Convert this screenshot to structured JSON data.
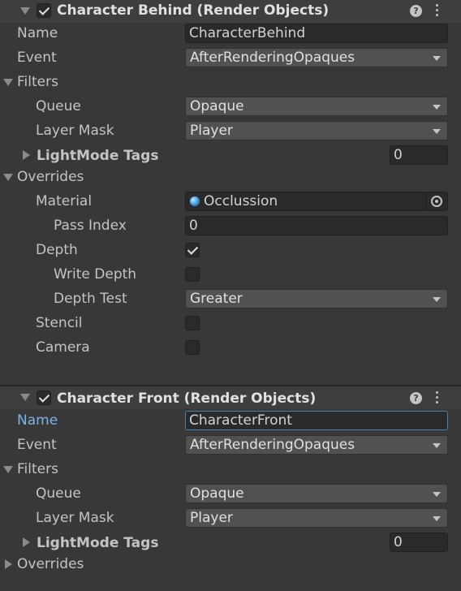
{
  "features": [
    {
      "title": "Character Behind (Render Objects)",
      "enabled": true,
      "name_label": "Name",
      "name_value": "CharacterBehind",
      "event_label": "Event",
      "event_value": "AfterRenderingOpaques",
      "filters_label": "Filters",
      "queue_label": "Queue",
      "queue_value": "Opaque",
      "layer_mask_label": "Layer Mask",
      "layer_mask_value": "Player",
      "lightmode_label": "LightMode Tags",
      "lightmode_value": "0",
      "overrides_label": "Overrides",
      "material_label": "Material",
      "material_value": "Occlussion",
      "pass_index_label": "Pass Index",
      "pass_index_value": "0",
      "depth_label": "Depth",
      "depth_checked": true,
      "write_depth_label": "Write Depth",
      "write_depth_checked": false,
      "depth_test_label": "Depth Test",
      "depth_test_value": "Greater",
      "stencil_label": "Stencil",
      "stencil_checked": false,
      "camera_label": "Camera",
      "camera_checked": false
    },
    {
      "title": "Character Front (Render Objects)",
      "enabled": true,
      "name_label": "Name",
      "name_value": "CharacterFront",
      "event_label": "Event",
      "event_value": "AfterRenderingOpaques",
      "filters_label": "Filters",
      "queue_label": "Queue",
      "queue_value": "Opaque",
      "layer_mask_label": "Layer Mask",
      "layer_mask_value": "Player",
      "lightmode_label": "LightMode Tags",
      "lightmode_value": "0",
      "overrides_label": "Overrides"
    }
  ],
  "icons": {
    "help": "?",
    "foldout_open": "triangle-down",
    "foldout_closed": "triangle-right",
    "object_picker": "target-circle",
    "material_icon": "sphere"
  },
  "colors": {
    "background": "#383838",
    "field": "#2a2a2a",
    "dropdown": "#515151",
    "focus": "#4c7fb0",
    "focused_label": "#7cb2e8"
  }
}
